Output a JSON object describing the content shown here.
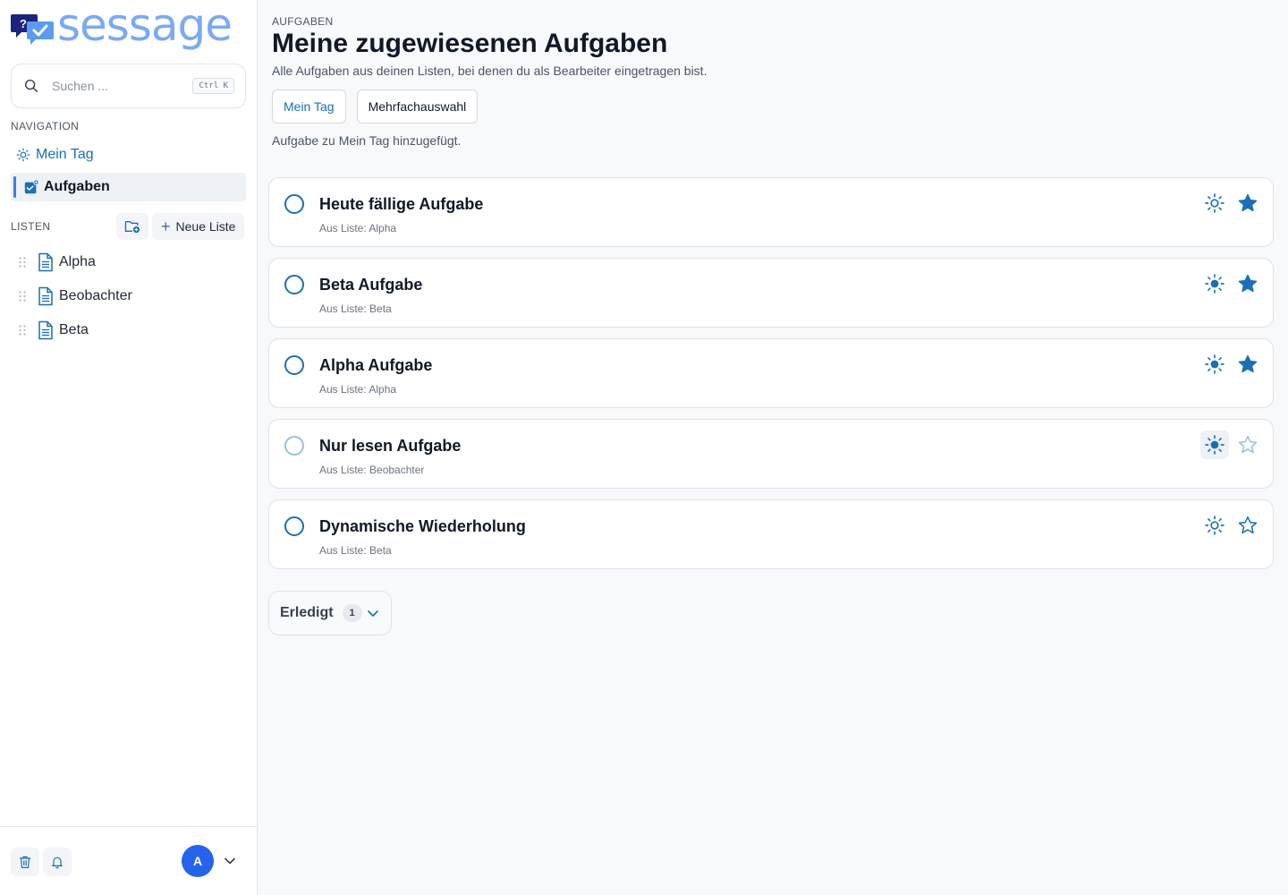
{
  "brand": {
    "name": "sessage",
    "logo_mark_glyph": "?"
  },
  "search": {
    "placeholder": "Suchen ...",
    "shortcut": "Ctrl K"
  },
  "navigation": {
    "label": "NAVIGATION",
    "items": [
      {
        "label": "Mein Tag",
        "icon": "sun-icon"
      },
      {
        "label": "Aufgaben",
        "icon": "tasks-icon",
        "active": true
      }
    ]
  },
  "lists": {
    "label": "LISTEN",
    "new_list_label": "Neue Liste",
    "items": [
      {
        "label": "Alpha"
      },
      {
        "label": "Beobachter"
      },
      {
        "label": "Beta"
      }
    ]
  },
  "user": {
    "initial": "A"
  },
  "page": {
    "eyebrow": "AUFGABEN",
    "title": "Meine zugewiesenen Aufgaben",
    "subtitle": "Alle Aufgaben aus deinen Listen, bei denen du als Bearbeiter eingetragen bist.",
    "buttons": {
      "my_day": "Mein Tag",
      "multi_select": "Mehrfachauswahl"
    },
    "status": "Aufgabe zu Mein Tag hinzugefügt."
  },
  "tasks": [
    {
      "title": "Heute fällige Aufgabe",
      "source": "Aus Liste: Alpha",
      "in_my_day": false,
      "important": true,
      "readonly": false
    },
    {
      "title": "Beta Aufgabe",
      "source": "Aus Liste: Beta",
      "in_my_day": true,
      "important": true,
      "readonly": false
    },
    {
      "title": "Alpha Aufgabe",
      "source": "Aus Liste: Alpha",
      "in_my_day": true,
      "important": true,
      "readonly": false
    },
    {
      "title": "Nur lesen Aufgabe",
      "source": "Aus Liste: Beobachter",
      "in_my_day": true,
      "important": false,
      "readonly": true
    },
    {
      "title": "Dynamische Wiederholung",
      "source": "Aus Liste: Beta",
      "in_my_day": false,
      "important": false,
      "readonly": false
    }
  ],
  "completed": {
    "label": "Erledigt",
    "count": "1"
  },
  "colors": {
    "accent": "#1a6fb8",
    "brand_light": "#7aa9f5",
    "avatar": "#2563eb"
  }
}
